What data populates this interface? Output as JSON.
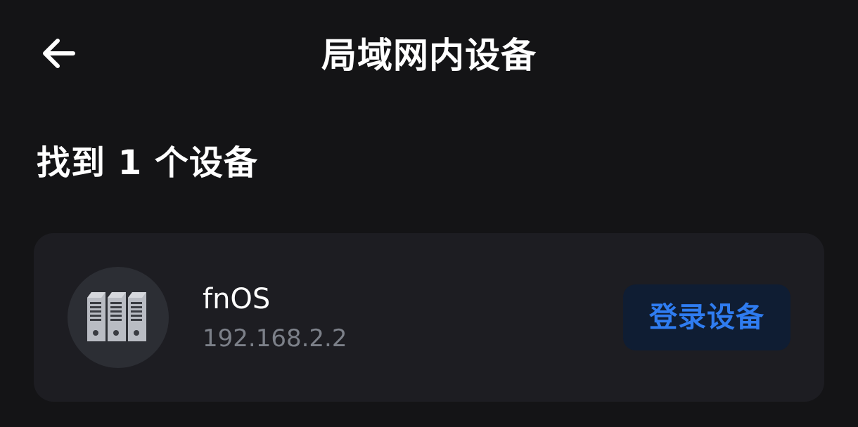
{
  "header": {
    "title": "局域网内设备",
    "back_icon": "arrow-left-icon"
  },
  "summary": {
    "found_text": "找到 1 个设备"
  },
  "devices": [
    {
      "icon": "server-icon",
      "name": "fnOS",
      "ip": "192.168.2.2",
      "action_label": "登录设备"
    }
  ],
  "colors": {
    "background": "#141416",
    "card": "#1d1d22",
    "avatar": "#2c2e34",
    "accent": "#2f7cf0",
    "button_bg": "#0f1d33",
    "secondary_text": "#7c8089"
  }
}
